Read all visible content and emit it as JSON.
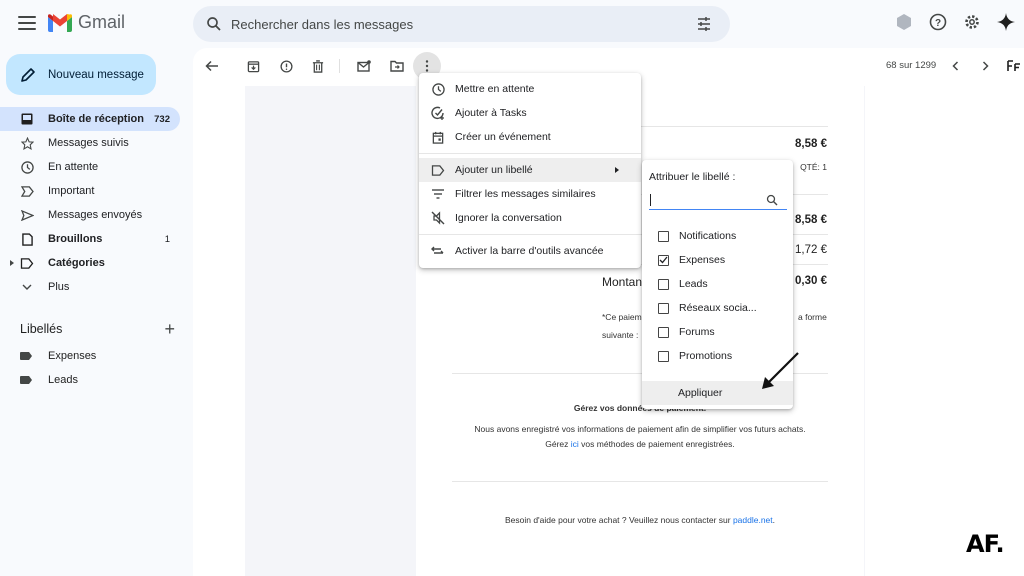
{
  "app": {
    "name": "Gmail"
  },
  "search": {
    "placeholder": "Rechercher dans les messages"
  },
  "compose": {
    "label": "Nouveau message"
  },
  "sidebar": {
    "items": [
      {
        "label": "Boîte de réception",
        "count": "732",
        "icon": "inbox-icon",
        "active": true
      },
      {
        "label": "Messages suivis",
        "icon": "star-icon"
      },
      {
        "label": "En attente",
        "icon": "clock-icon"
      },
      {
        "label": "Important",
        "icon": "important-icon"
      },
      {
        "label": "Messages envoyés",
        "icon": "send-icon"
      },
      {
        "label": "Brouillons",
        "count": "1",
        "icon": "draft-icon"
      },
      {
        "label": "Catégories",
        "icon": "label-outline-icon"
      },
      {
        "label": "Plus",
        "icon": "chevron-down-icon"
      }
    ],
    "labels_title": "Libellés",
    "labels": [
      {
        "label": "Expenses"
      },
      {
        "label": "Leads"
      }
    ]
  },
  "toolbar": {
    "pager": "68 sur 1299"
  },
  "menu": {
    "items": [
      {
        "label": "Mettre en attente",
        "icon": "clock-icon"
      },
      {
        "label": "Ajouter à Tasks",
        "icon": "add-task-icon"
      },
      {
        "label": "Créer un événement",
        "icon": "calendar-icon"
      },
      {
        "label": "Ajouter un libellé",
        "icon": "label-icon"
      },
      {
        "label": "Filtrer les messages similaires",
        "icon": "filter-icon"
      },
      {
        "label": "Ignorer la conversation",
        "icon": "mute-icon"
      },
      {
        "label": "Activer la barre d'outils avancée",
        "icon": "swap-icon"
      }
    ]
  },
  "label_submenu": {
    "title": "Attribuer le libellé :",
    "search_value": "",
    "options": [
      {
        "label": "Notifications",
        "checked": false
      },
      {
        "label": "Expenses",
        "checked": true
      },
      {
        "label": "Leads",
        "checked": false
      },
      {
        "label": "Réseaux socia...",
        "checked": false
      },
      {
        "label": "Forums",
        "checked": false
      },
      {
        "label": "Promotions",
        "checked": false
      }
    ],
    "apply_label": "Appliquer"
  },
  "email": {
    "amount_1": "8,58 €",
    "qty": "QTÉ: 1",
    "subtotal": "8,58 €",
    "tax": "1,72 €",
    "total_label": "Montan",
    "total": "0,30 €",
    "note_1": "*Ce paiem",
    "note_1_end": "a forme",
    "note_2": "suivante :",
    "payment_title": "Gérez vos données de paiement.",
    "payment_line1": "Nous avons enregistré vos informations de paiement afin de simplifier vos futurs achats.",
    "payment_line2_pre": "Gérez ",
    "payment_line2_link": "ici",
    "payment_line2_post": " vos méthodes de paiement enregistrées.",
    "help_pre": "Besoin d'aide pour votre achat ? Veuillez nous contacter sur ",
    "help_link": "paddle.net",
    "help_post": "."
  },
  "watermark": "AF."
}
